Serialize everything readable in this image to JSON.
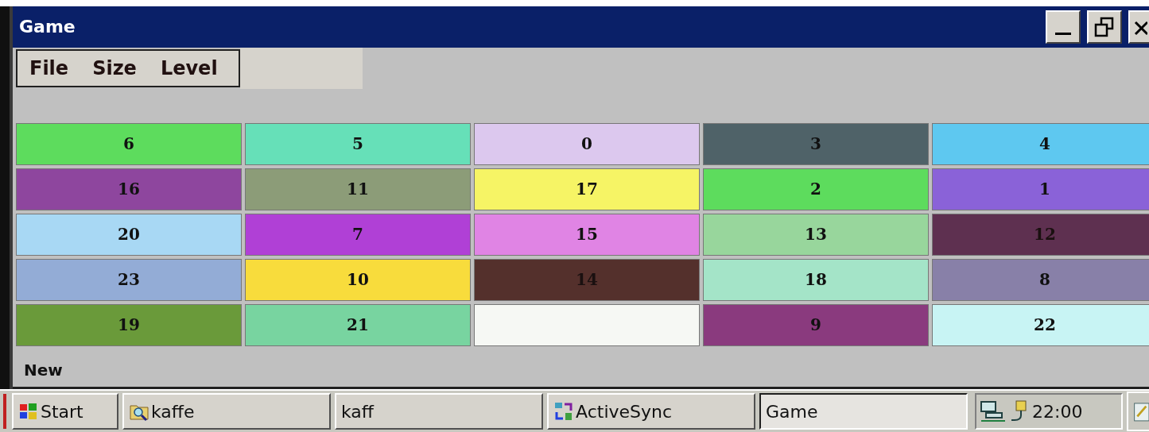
{
  "window": {
    "title": "Game"
  },
  "menu": [
    {
      "label": "File"
    },
    {
      "label": "Size"
    },
    {
      "label": "Level"
    }
  ],
  "tiles": [
    {
      "label": "6",
      "color": "#5ddc5d"
    },
    {
      "label": "5",
      "color": "#66e0b8"
    },
    {
      "label": "0",
      "color": "#dcc8ee"
    },
    {
      "label": "3",
      "color": "#4f6268"
    },
    {
      "label": "4",
      "color": "#5ec8f0"
    },
    {
      "label": "16",
      "color": "#8e469e"
    },
    {
      "label": "11",
      "color": "#8c9c78"
    },
    {
      "label": "17",
      "color": "#f6f465"
    },
    {
      "label": "2",
      "color": "#5ddc5d"
    },
    {
      "label": "1",
      "color": "#8a62d8"
    },
    {
      "label": "20",
      "color": "#a8d8f4"
    },
    {
      "label": "7",
      "color": "#b040d6"
    },
    {
      "label": "15",
      "color": "#e084e4"
    },
    {
      "label": "13",
      "color": "#98d69c"
    },
    {
      "label": "12",
      "color": "#5e3050"
    },
    {
      "label": "23",
      "color": "#93acd6"
    },
    {
      "label": "10",
      "color": "#f8dc3c"
    },
    {
      "label": "14",
      "color": "#54302c"
    },
    {
      "label": "18",
      "color": "#a4e4c8"
    },
    {
      "label": "8",
      "color": "#8880a8"
    },
    {
      "label": "19",
      "color": "#6a9a3a"
    },
    {
      "label": "21",
      "color": "#78d4a0"
    },
    {
      "color": "#f6f8f4"
    },
    {
      "label": "9",
      "color": "#8a3a7e"
    },
    {
      "label": "22",
      "color": "#c8f4f4"
    }
  ],
  "status": "New",
  "taskbar": {
    "start": "Start",
    "items": [
      {
        "label": "kaffe",
        "kind": "folder",
        "selected": false
      },
      {
        "label": "kaff",
        "kind": "plain",
        "selected": false
      },
      {
        "label": "ActiveSync",
        "kind": "sync",
        "selected": false
      },
      {
        "label": "Game",
        "kind": "plain",
        "selected": true
      }
    ],
    "clock": "22:00"
  }
}
